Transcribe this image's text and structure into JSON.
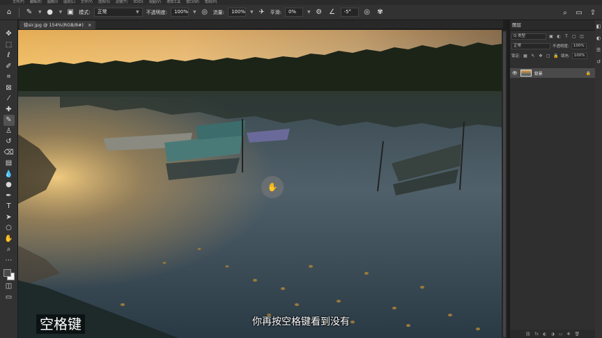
{
  "menubar": {
    "items": [
      "文件(F)",
      "编辑(E)",
      "图像(I)",
      "图层(L)",
      "文字(Y)",
      "选择(S)",
      "滤镜(T)",
      "3D(D)",
      "视图(V)",
      "增效工具",
      "窗口(W)",
      "帮助(H)"
    ]
  },
  "options": {
    "mode_label": "模式:",
    "mode_value": "正常",
    "opacity_label": "不透明度:",
    "opacity_value": "100%",
    "flow_label": "流量:",
    "flow_value": "100%",
    "smoothing_label": "平滑:",
    "smoothing_value": "0%",
    "angle_value": "-5°"
  },
  "document": {
    "tab_title": "徐sir.jpg @ 154%(RGB/8#)",
    "close_glyph": "×"
  },
  "layers_panel": {
    "tab_title": "图层",
    "filter_kind": "Q 类型",
    "blend_mode": "正常",
    "opacity_label": "不透明度:",
    "opacity_value": "100%",
    "lock_label": "锁定:",
    "fill_label": "填充:",
    "fill_value": "100%",
    "layer_name": "背景"
  },
  "overlay": {
    "caption_left": "空格键",
    "caption_center": "你再按空格键看到没有"
  },
  "colors": {
    "ui_dark": "#323232",
    "canvas_bg": "#1e1e1e",
    "foreground_swatch": "#4a4a4a",
    "background_swatch": "#f4f4f4"
  }
}
